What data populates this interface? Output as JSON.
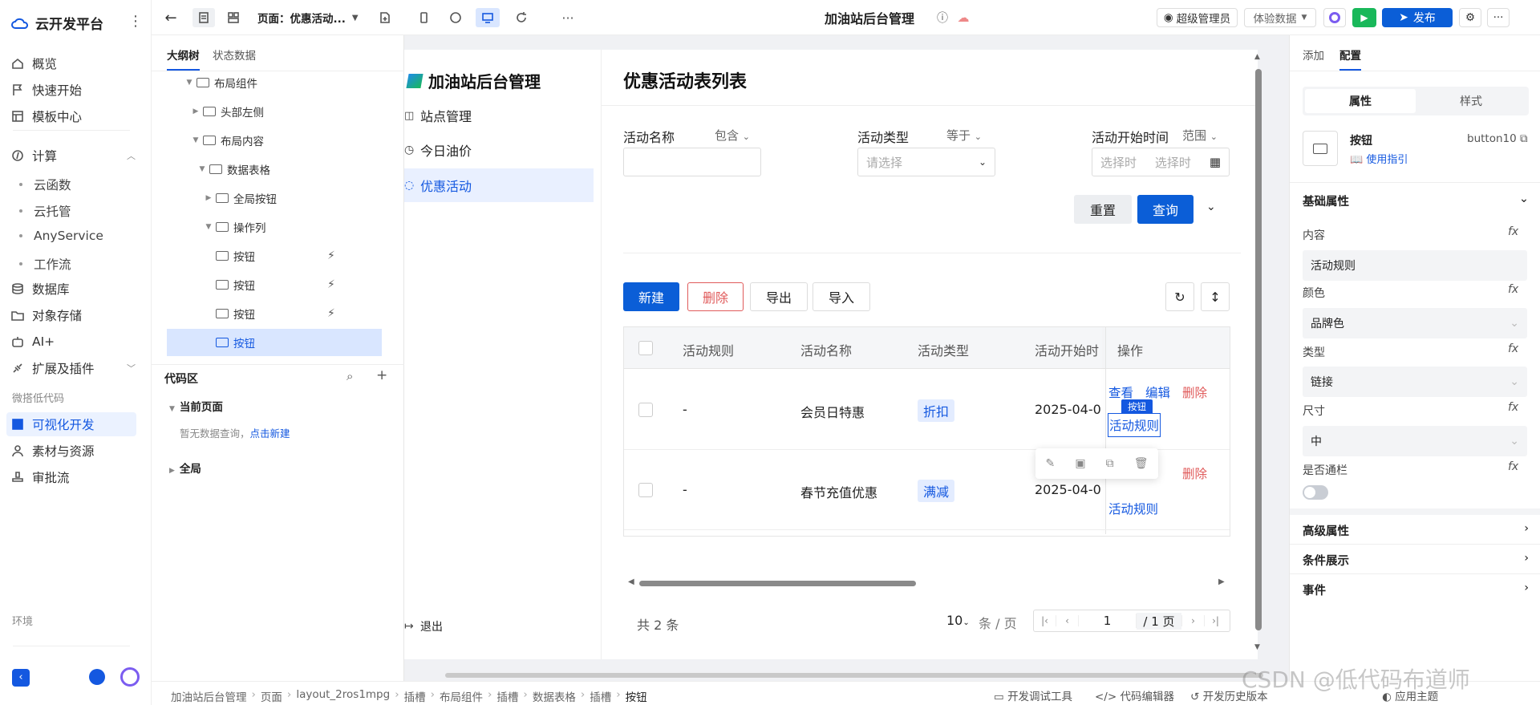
{
  "nav": {
    "brand": "云开发平台",
    "items": [
      {
        "label": "概览",
        "icon": "home-icon"
      },
      {
        "label": "快速开始",
        "icon": "flag-icon"
      },
      {
        "label": "模板中心",
        "icon": "template-icon"
      }
    ],
    "compute": {
      "label": "计算",
      "subs": [
        "云函数",
        "云托管",
        "AnyService",
        "工作流"
      ]
    },
    "items2": [
      {
        "label": "数据库",
        "icon": "database-icon"
      },
      {
        "label": "对象存储",
        "icon": "folder-icon"
      },
      {
        "label": "AI+",
        "icon": "robot-icon"
      },
      {
        "label": "扩展及插件",
        "icon": "plugin-icon"
      }
    ],
    "group_lowcode": "微搭低代码",
    "items3": [
      {
        "label": "可视化开发",
        "icon": "layout-icon"
      },
      {
        "label": "素材与资源",
        "icon": "user-icon"
      },
      {
        "label": "审批流",
        "icon": "stamp-icon"
      }
    ],
    "group_env": "环境"
  },
  "topbar": {
    "page_select": "页面：优惠活动...",
    "app_title": "加油站后台管理",
    "admin": "超级管理员",
    "data_mode": "体验数据",
    "publish": "发布"
  },
  "tree": {
    "tab_outline": "大纲树",
    "tab_state": "状态数据",
    "nodes": [
      "布局组件",
      "头部左侧",
      "布局内容",
      "数据表格",
      "全局按钮",
      "操作列",
      "按钮",
      "按钮",
      "按钮",
      "按钮"
    ],
    "code_title": "代码区",
    "current_page": "当前页面",
    "no_query": "暂无数据查询，",
    "create_link": "点击新建",
    "global": "全局"
  },
  "app": {
    "brand": "加油站后台管理",
    "menu": [
      "站点管理",
      "今日油价",
      "优惠活动"
    ],
    "logout": "退出",
    "page_title": "优惠活动表列表",
    "filters": {
      "name_label": "活动名称",
      "name_op": "包含",
      "type_label": "活动类型",
      "type_op": "等于",
      "type_placeholder": "请选择",
      "start_label": "活动开始时间",
      "start_op": "范围",
      "start_ph1": "选择时",
      "start_ph2": "选择时"
    },
    "reset": "重置",
    "query": "查询",
    "toolbar": {
      "new": "新建",
      "delete": "删除",
      "export": "导出",
      "import": "导入"
    },
    "columns": [
      "活动规则",
      "活动名称",
      "活动类型",
      "活动开始时",
      "操作"
    ],
    "rows": [
      {
        "rule": "-",
        "name": "会员日特惠",
        "type": "折扣",
        "start": "2025-04-0"
      },
      {
        "rule": "-",
        "name": "春节充值优惠",
        "type": "满减",
        "start": "2025-04-0"
      }
    ],
    "actions": {
      "view": "查看",
      "edit": "编辑",
      "delete": "删除",
      "rule": "活动规则"
    },
    "selected_tag": "按钮",
    "pager": {
      "total": "共 2 条",
      "size": "10",
      "per": "条 / 页",
      "page": "1",
      "of": "/ 1 页"
    }
  },
  "props": {
    "tab_add": "添加",
    "tab_config": "配置",
    "seg_attr": "属性",
    "seg_style": "样式",
    "comp_name": "按钮",
    "comp_id": "button10",
    "guide": "使用指引",
    "basic": "基础属性",
    "content_label": "内容",
    "content_value": "活动规则",
    "color_label": "颜色",
    "color_value": "品牌色",
    "type_label": "类型",
    "type_value": "链接",
    "size_label": "尺寸",
    "size_value": "中",
    "block_label": "是否通栏",
    "advanced": "高级属性",
    "condition": "条件展示",
    "event": "事件"
  },
  "bottom": {
    "crumbs": [
      "加油站后台管理",
      "页面",
      "layout_2ros1mpg",
      "插槽",
      "布局组件",
      "插槽",
      "数据表格",
      "插槽",
      "按钮"
    ],
    "devtools": "开发调试工具",
    "code_editor": "代码编辑器",
    "history": "开发历史版本",
    "theme": "应用主题"
  },
  "watermark": "CSDN @低代码布道师",
  "colors": {
    "primary": "#0b5ed7",
    "danger": "#e05b5b",
    "link": "#1458e0",
    "green": "#19b85a"
  }
}
